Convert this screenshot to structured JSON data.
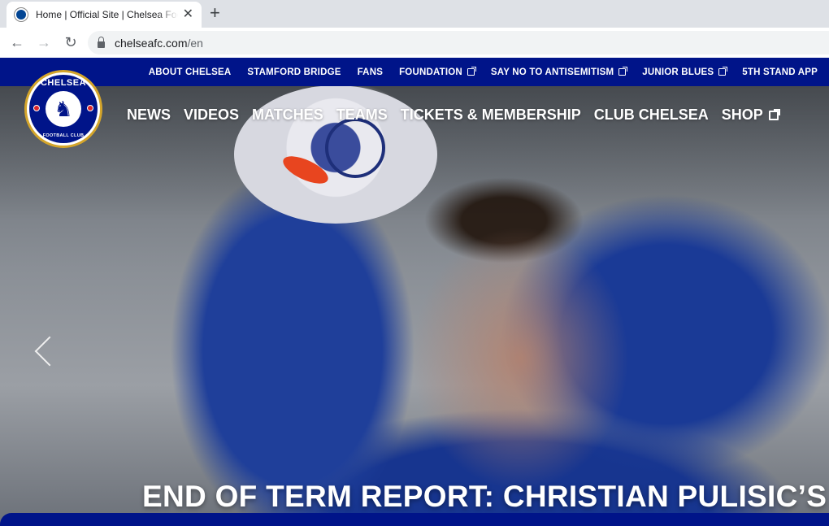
{
  "browser": {
    "tab_title": "Home | Official Site | Chelsea Football Club",
    "tab_close": "✕",
    "new_tab": "+",
    "back": "←",
    "forward": "→",
    "reload": "↻",
    "url_domain": "chelseafc.com",
    "url_path": "/en"
  },
  "site": {
    "top_nav": [
      {
        "label": "ABOUT CHELSEA",
        "external": false
      },
      {
        "label": "STAMFORD BRIDGE",
        "external": false
      },
      {
        "label": "FANS",
        "external": false
      },
      {
        "label": "FOUNDATION",
        "external": true
      },
      {
        "label": "SAY NO TO ANTISEMITISM",
        "external": true
      },
      {
        "label": "JUNIOR BLUES",
        "external": true
      },
      {
        "label": "5TH STAND APP",
        "external": false
      }
    ],
    "main_nav": [
      {
        "label": "NEWS",
        "external": false
      },
      {
        "label": "VIDEOS",
        "external": false
      },
      {
        "label": "MATCHES",
        "external": false
      },
      {
        "label": "TEAMS",
        "external": false
      },
      {
        "label": "TICKETS & MEMBERSHIP",
        "external": false
      },
      {
        "label": "CLUB CHELSEA",
        "external": false
      },
      {
        "label": "SHOP",
        "external": true
      }
    ],
    "crest": {
      "top_text": "CHELSEA",
      "bottom_text": "FOOTBALL CLUB",
      "lion": "♞"
    },
    "hero": {
      "headline": "END OF TERM REPORT: CHRISTIAN PULISIC’S"
    },
    "icons": {
      "prev_arrow": "chevron-left-icon",
      "external": "external-link-icon",
      "lock": "lock-icon"
    },
    "colors": {
      "brand_blue": "#001489",
      "gold": "#d4a52b"
    }
  }
}
